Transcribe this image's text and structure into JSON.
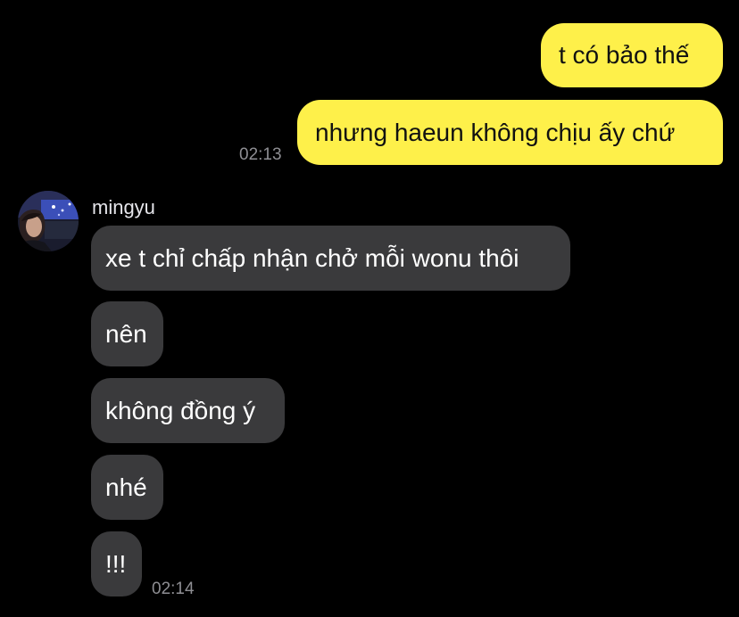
{
  "outgoing": [
    {
      "text": "t có bảo thế"
    },
    {
      "text": "nhưng haeun không chịu ấy chứ"
    }
  ],
  "outgoing_time": "02:13",
  "sender": {
    "name": "mingyu"
  },
  "incoming": [
    {
      "text": "xe t chỉ chấp nhận chở mỗi wonu thôi"
    },
    {
      "text": "nên"
    },
    {
      "text": "không đồng ý"
    },
    {
      "text": "nhé"
    },
    {
      "text": "!!!"
    }
  ],
  "incoming_time": "02:14",
  "colors": {
    "outgoing_bubble": "#FEF04A",
    "incoming_bubble": "#3A3A3C",
    "background": "#000000",
    "timestamp": "#8E8E93"
  }
}
